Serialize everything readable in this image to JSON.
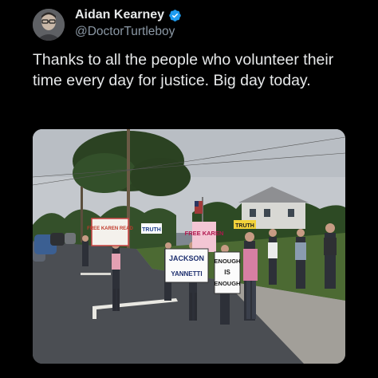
{
  "tweet": {
    "author": {
      "display_name": "Aidan Kearney",
      "handle": "@DoctorTurtleboy",
      "verified": true,
      "verified_color": "#1d9bf0",
      "avatar_icon": "profile-photo"
    },
    "text": "Thanks to all the people who volunteer their time every day for justice. Big day today.",
    "media": {
      "signs": {
        "left_sign": "FREE KAREN READ",
        "truth_sign": "TRUTH",
        "pink_sign": "FREE KAREN",
        "yellow_sign": "TRUTH",
        "jackson_sign_line1": "JACKSON",
        "jackson_sign_line2": "YANNETTI",
        "enough_sign_line1": "ENOUGH",
        "enough_sign_line2": "IS",
        "enough_sign_line3": "ENOUGH"
      },
      "colors": {
        "sky": "#c9cdd2",
        "road": "#4a4d52",
        "grass": "#4f6b34",
        "trees": "#2f4a25",
        "sidewalk": "#9a9791"
      }
    }
  }
}
